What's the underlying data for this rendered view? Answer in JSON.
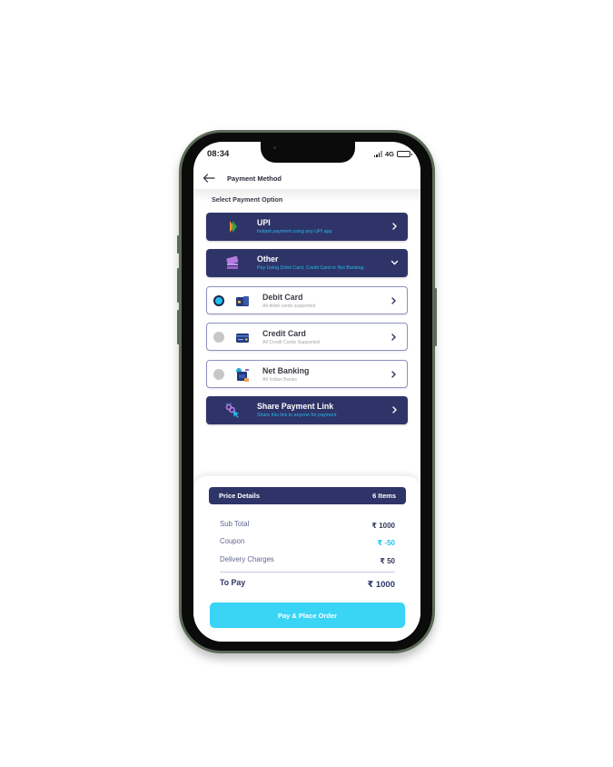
{
  "status_bar": {
    "time": "08:34",
    "network": "4G",
    "battery_level": 0.65
  },
  "header": {
    "title": "Payment Method",
    "back_icon": "arrow-left-icon"
  },
  "section_label": "Select Payment Option",
  "payment_options": [
    {
      "id": "upi",
      "title": "UPI",
      "subtitle": "Instant payment using any UPI app",
      "icon": "upi-logo-icon",
      "style": "dark",
      "indicator": "chevron-right-icon"
    },
    {
      "id": "other",
      "title": "Other",
      "subtitle": "Pay Using Debit Card, Credit Card or Net Banking",
      "icon": "card-stack-icon",
      "style": "dark",
      "indicator": "chevron-down-icon",
      "expanded": true
    },
    {
      "id": "debit",
      "title": "Debit Card",
      "subtitle": "All debit cards supported",
      "icon": "debit-card-icon",
      "style": "light",
      "selected": true,
      "indicator": "chevron-right-icon"
    },
    {
      "id": "credit",
      "title": "Credit Card",
      "subtitle": "All Credit Cards Supported",
      "icon": "credit-card-icon",
      "style": "light",
      "selected": false,
      "indicator": "chevron-right-icon"
    },
    {
      "id": "netbanking",
      "title": "Net Banking",
      "subtitle": "All Indian Banks",
      "icon": "bank-icon",
      "style": "light",
      "selected": false,
      "indicator": "chevron-right-icon"
    },
    {
      "id": "share",
      "title": "Share Payment Link",
      "subtitle": "Share this link to anyone for payment",
      "icon": "share-link-icon",
      "style": "dark",
      "indicator": "chevron-right-icon"
    }
  ],
  "price_details": {
    "title": "Price Details",
    "items_count": "6 Items",
    "rows": [
      {
        "label": "Sub Total",
        "value": "₹ 1000"
      },
      {
        "label": "Coupon",
        "value": "₹ -50"
      },
      {
        "label": "Delivery Charges",
        "value": "₹ 50"
      }
    ],
    "total": {
      "label": "To Pay",
      "value": "₹ 1000"
    }
  },
  "cta": {
    "label": "Pay & Place Order"
  },
  "colors": {
    "primary": "#2f3468",
    "accent": "#3ad4f5",
    "subtitle_cyan": "#27b8ea",
    "radio_selected": "#1ec3ef"
  }
}
